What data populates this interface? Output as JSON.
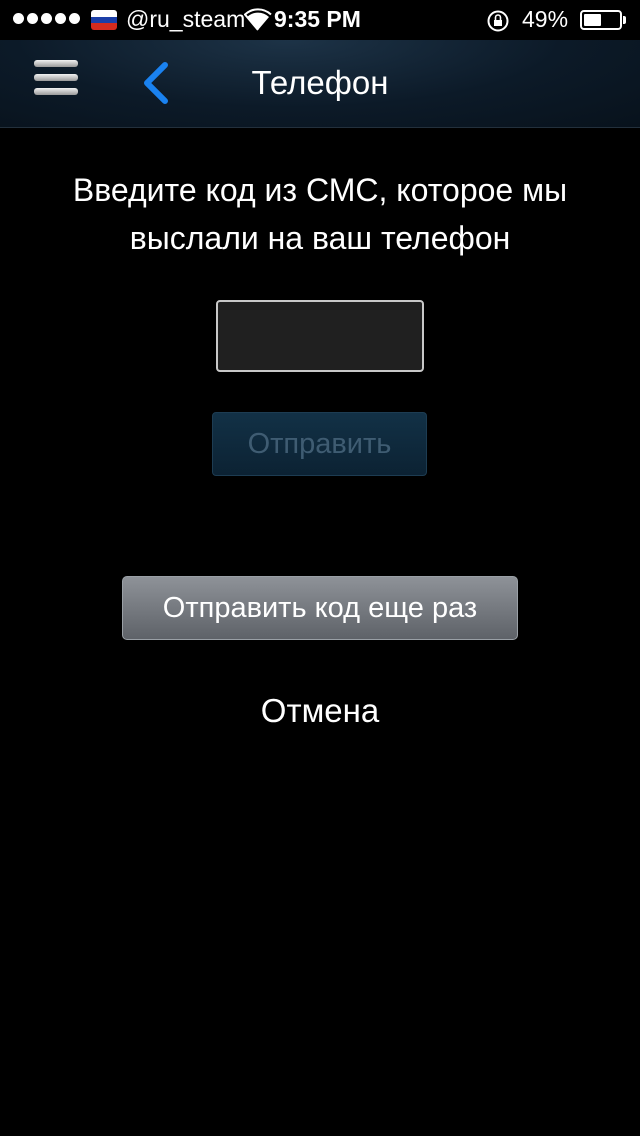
{
  "status_bar": {
    "signal_icon": "signal-dots-icon",
    "flag_colors": [
      "#ffffff",
      "#1c3fa8",
      "#d52b1e"
    ],
    "carrier": "@ru_steam",
    "wifi_icon": "wifi-icon",
    "time": "9:35 PM",
    "orientation_lock_icon": "orientation-lock-icon",
    "battery_percent": "49%",
    "battery_level": 0.49
  },
  "nav": {
    "menu_icon": "hamburger-menu-icon",
    "back_icon": "chevron-left-icon",
    "title": "Телефон",
    "accent_color": "#1a82f0"
  },
  "content": {
    "instruction_line1": "Введите код из СМС, которое мы",
    "instruction_line2": "выслали на ваш телефон",
    "code_value": "",
    "submit_label": "Отправить",
    "resend_label": "Отправить код еще раз",
    "cancel_label": "Отмена"
  }
}
